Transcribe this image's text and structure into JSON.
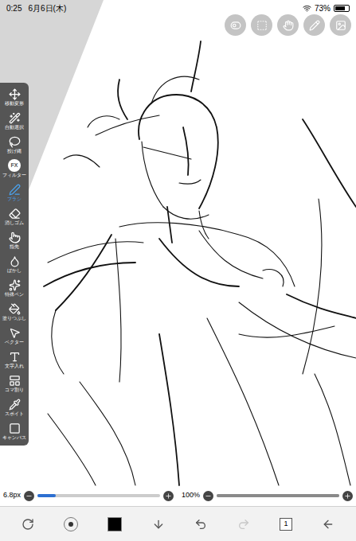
{
  "status_bar": {
    "time": "0:25",
    "date": "6月6日(木)",
    "battery": "73%",
    "battery_level": 0.73
  },
  "tools": [
    {
      "label": "移動変形",
      "selected": false,
      "glyph": ""
    },
    {
      "label": "自動選択",
      "selected": false,
      "glyph": ""
    },
    {
      "label": "投げ縄",
      "selected": false,
      "glyph": ""
    },
    {
      "label": "フィルター",
      "selected": false,
      "glyph": "FX"
    },
    {
      "label": "ブラシ",
      "selected": true,
      "glyph": ""
    },
    {
      "label": "消しゴム",
      "selected": false,
      "glyph": ""
    },
    {
      "label": "指先",
      "selected": false,
      "glyph": ""
    },
    {
      "label": "ぼかし",
      "selected": false,
      "glyph": ""
    },
    {
      "label": "特殊ペン",
      "selected": false,
      "glyph": ""
    },
    {
      "label": "塗りつぶし",
      "selected": false,
      "glyph": ""
    },
    {
      "label": "ベクター",
      "selected": false,
      "glyph": ""
    },
    {
      "label": "文字入れ",
      "selected": false,
      "glyph": ""
    },
    {
      "label": "コマ割り",
      "selected": false,
      "glyph": ""
    },
    {
      "label": "スポイト",
      "selected": false,
      "glyph": ""
    },
    {
      "label": "キャンバス",
      "selected": false,
      "glyph": ""
    }
  ],
  "brush_size": {
    "reading": "6.8px",
    "level": 0.15
  },
  "opacity": {
    "reading": "100%",
    "level": 1.0
  },
  "current_color": "#000000",
  "layer_count": "1",
  "redo_enabled": false
}
